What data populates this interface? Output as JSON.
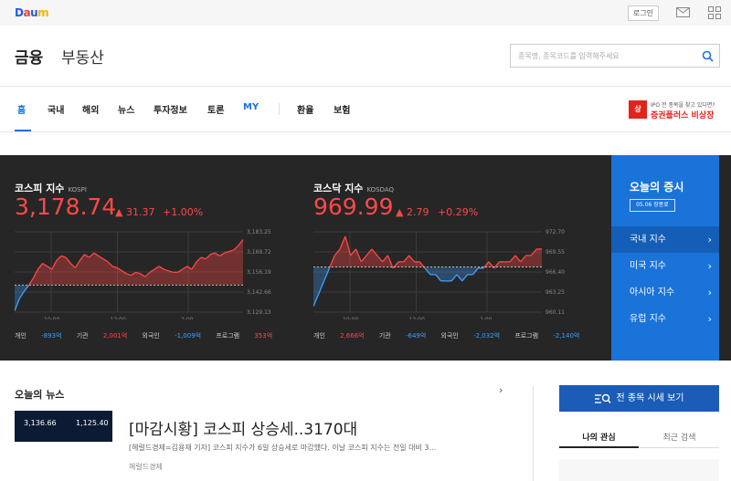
{
  "topbar": {
    "logo": "Daum",
    "login_label": "로그인"
  },
  "header": {
    "title_finance": "금융",
    "title_realestate": "부동산",
    "search_placeholder": "종목명, 종목코드를 입력해주세요"
  },
  "nav": {
    "items": [
      "홈",
      "국내",
      "해외",
      "뉴스",
      "투자정보",
      "토론",
      "MY",
      "환율",
      "보험"
    ],
    "active_index": 0,
    "ad_line1": "IPO 전 종목을 찾고 있다면?",
    "ad_line2": "증권플러스 비상장",
    "ad_icon": "상"
  },
  "kospi": {
    "name": "코스피 지수",
    "code": "KOSPI",
    "value": "3,178.74",
    "change": "▲ 31.37",
    "change_pct": "+1.00%",
    "investors": {
      "individual_label": "개인",
      "individual": "-893억",
      "inst_label": "기관",
      "inst": "2,001억",
      "foreign_label": "외국인",
      "foreign": "-1,009억",
      "program_label": "프로그램",
      "program": "353억"
    }
  },
  "kosdaq": {
    "name": "코스닥 지수",
    "code": "KOSDAQ",
    "value": "969.99",
    "change": "▲ 2.79",
    "change_pct": "+0.29%",
    "investors": {
      "individual_label": "개인",
      "individual": "2,666억",
      "inst_label": "기관",
      "inst": "-649억",
      "foreign_label": "외국인",
      "foreign": "-2,032억",
      "program_label": "프로그램",
      "program": "-2,140억"
    }
  },
  "chart_data": [
    {
      "type": "line",
      "title": "코스피 지수",
      "x_ticks": [
        "10:00",
        "12:00",
        "2:00"
      ],
      "y_ticks": [
        "3,183.25",
        "3,169.72",
        "3,156.19",
        "3,142.66",
        "3,129.13"
      ],
      "ylim": [
        3129.13,
        3183.25
      ],
      "baseline": 3147.37,
      "values": [
        3130,
        3138,
        3143,
        3147,
        3152,
        3158,
        3162,
        3160,
        3158,
        3164,
        3167,
        3166,
        3162,
        3159,
        3164,
        3168,
        3166,
        3169,
        3167,
        3165,
        3163,
        3160,
        3159,
        3157,
        3155,
        3154,
        3156,
        3155,
        3153,
        3156,
        3158,
        3160,
        3158,
        3157,
        3156,
        3156,
        3158,
        3160,
        3158,
        3163,
        3166,
        3165,
        3168,
        3169,
        3167,
        3169,
        3170,
        3171,
        3174,
        3178
      ]
    },
    {
      "type": "line",
      "title": "코스닥 지수",
      "x_ticks": [
        "10:00",
        "12:00",
        "2:00"
      ],
      "y_ticks": [
        "972.70",
        "969.55",
        "966.40",
        "963.25",
        "960.11"
      ],
      "ylim": [
        960.11,
        972.7
      ],
      "baseline": 967.2,
      "values": [
        961,
        963,
        965,
        967,
        969,
        970,
        972,
        969,
        970,
        968,
        969,
        970,
        969,
        968,
        969,
        967,
        968,
        968,
        969,
        968,
        968,
        967,
        966,
        966,
        965,
        965,
        965,
        966,
        965,
        966,
        966,
        967,
        967,
        968,
        967,
        968,
        968,
        968,
        969,
        968,
        969,
        969,
        970,
        970
      ]
    }
  ],
  "side": {
    "title": "오늘의 증시",
    "date": "05.06 장종료",
    "items": [
      "국내 지수",
      "미국 지수",
      "아시아 지수",
      "유럽 지수"
    ],
    "active_index": 0
  },
  "news": {
    "section_title": "오늘의 뉴스",
    "thumb_a": "3,136.66",
    "thumb_b": "1,125.40",
    "headline": "[마감시황] 코스피 상승세..3170대",
    "snippet": "[헤럴드경제=김용재 기자] 코스피 지수가 6일 상승세로 마감했다. 이날 코스피 지수는 전일 대비 3...",
    "source": "헤럴드경제"
  },
  "right": {
    "all_button": "전 종목 시세 보기",
    "tab_interest": "나의 관심",
    "tab_recent": "최근 검색"
  },
  "colors": {
    "up": "#ff4848",
    "down": "#3ea0ff",
    "accent": "#1a73d9"
  }
}
